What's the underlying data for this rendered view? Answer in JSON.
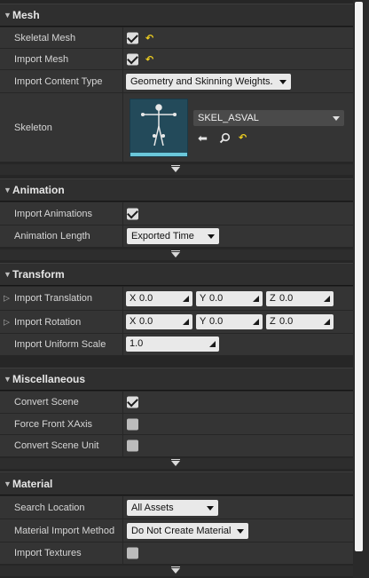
{
  "sections": {
    "mesh": {
      "title": "Mesh",
      "skeletal_mesh": {
        "label": "Skeletal Mesh",
        "checked": true
      },
      "import_mesh": {
        "label": "Import Mesh",
        "checked": true
      },
      "import_content_type": {
        "label": "Import Content Type",
        "value": "Geometry and Skinning Weights."
      },
      "skeleton": {
        "label": "Skeleton",
        "asset": "SKEL_ASVAL"
      }
    },
    "animation": {
      "title": "Animation",
      "import_animations": {
        "label": "Import Animations",
        "checked": true
      },
      "animation_length": {
        "label": "Animation Length",
        "value": "Exported Time"
      }
    },
    "transform": {
      "title": "Transform",
      "import_translation": {
        "label": "Import Translation",
        "x_axis": "X",
        "x": "0.0",
        "y_axis": "Y",
        "y": "0.0",
        "z_axis": "Z",
        "z": "0.0"
      },
      "import_rotation": {
        "label": "Import Rotation",
        "x_axis": "X",
        "x": "0.0",
        "y_axis": "Y",
        "y": "0.0",
        "z_axis": "Z",
        "z": "0.0"
      },
      "import_uniform_scale": {
        "label": "Import Uniform Scale",
        "value": "1.0"
      }
    },
    "miscellaneous": {
      "title": "Miscellaneous",
      "convert_scene": {
        "label": "Convert Scene",
        "checked": true
      },
      "force_front_xaxis": {
        "label": "Force Front XAxis",
        "checked": false
      },
      "convert_scene_unit": {
        "label": "Convert Scene Unit",
        "checked": false
      }
    },
    "material": {
      "title": "Material",
      "search_location": {
        "label": "Search Location",
        "value": "All Assets"
      },
      "material_import_method": {
        "label": "Material Import Method",
        "value": "Do Not Create Material"
      },
      "import_textures": {
        "label": "Import Textures",
        "checked": false
      }
    }
  },
  "icons": {
    "reset": "reset-to-default-icon",
    "use_selected": "arrow-left-icon",
    "browse": "search-icon",
    "collapse": "collapse-advanced-icon",
    "expand": "expand-arrow-icon"
  },
  "colors": {
    "panel_bg": "#262626",
    "row_bg": "#343434",
    "header_bg": "#2f2f2f",
    "reset_icon": "#f0d020",
    "thumbnail_bg": "#234a5a",
    "thumbnail_accent": "#6ac7da",
    "field_bg": "#e9e9e9"
  }
}
